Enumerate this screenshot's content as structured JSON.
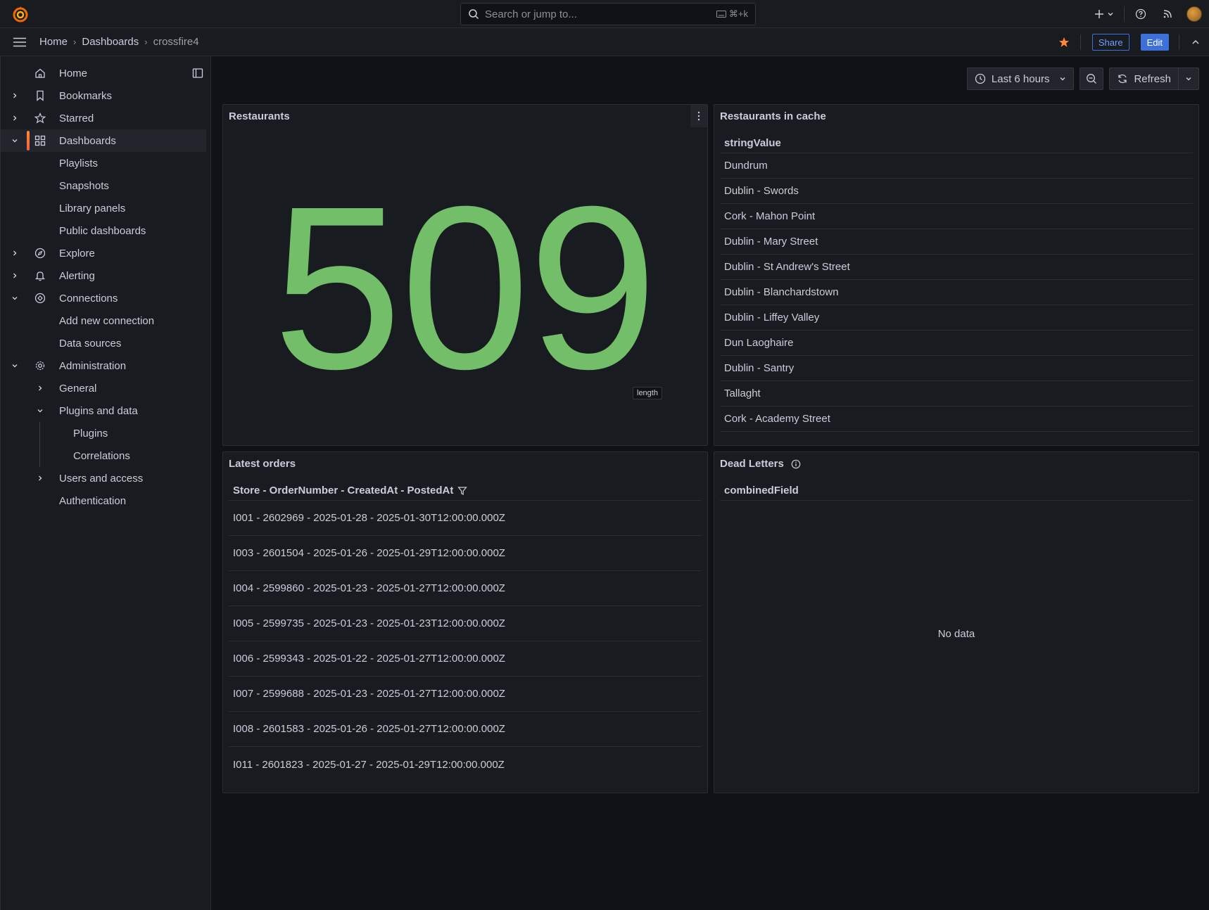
{
  "app": {
    "accent_color": "#3d71d9",
    "stat_color": "#73bf69",
    "favorite_color": "#ff8833"
  },
  "topbar": {
    "search_placeholder": "Search or jump to...",
    "search_shortcut": "⌘+k"
  },
  "breadcrumb": {
    "items": [
      "Home",
      "Dashboards",
      "crossfire4"
    ],
    "share_label": "Share",
    "edit_label": "Edit"
  },
  "sidebar": {
    "items": [
      {
        "label": "Home",
        "icon": "home-icon"
      },
      {
        "label": "Bookmarks",
        "icon": "bookmark-icon"
      },
      {
        "label": "Starred",
        "icon": "star-icon"
      },
      {
        "label": "Dashboards",
        "icon": "apps-icon"
      },
      {
        "label": "Playlists"
      },
      {
        "label": "Snapshots"
      },
      {
        "label": "Library panels"
      },
      {
        "label": "Public dashboards"
      },
      {
        "label": "Explore",
        "icon": "compass-icon"
      },
      {
        "label": "Alerting",
        "icon": "bell-icon"
      },
      {
        "label": "Connections",
        "icon": "connections-icon"
      },
      {
        "label": "Add new connection"
      },
      {
        "label": "Data sources"
      },
      {
        "label": "Administration",
        "icon": "cog-icon"
      },
      {
        "label": "General"
      },
      {
        "label": "Plugins and data"
      },
      {
        "label": "Plugins"
      },
      {
        "label": "Correlations"
      },
      {
        "label": "Users and access"
      },
      {
        "label": "Authentication"
      }
    ]
  },
  "toolbar": {
    "time_range": "Last 6 hours",
    "refresh_label": "Refresh"
  },
  "panels": {
    "restaurants": {
      "title": "Restaurants",
      "value": "509",
      "field_label": "length"
    },
    "cache": {
      "title": "Restaurants in cache",
      "column": "stringValue",
      "rows": [
        "Dundrum",
        "Dublin - Swords",
        "Cork - Mahon Point",
        "Dublin - Mary Street",
        "Dublin - St Andrew's Street",
        "Dublin - Blanchardstown",
        "Dublin - Liffey Valley",
        "Dun Laoghaire",
        "Dublin - Santry",
        "Tallaght",
        "Cork - Academy Street"
      ]
    },
    "orders": {
      "title": "Latest orders",
      "column": "Store - OrderNumber - CreatedAt - PostedAt",
      "rows": [
        "I001 - 2602969 - 2025-01-28 - 2025-01-30T12:00:00.000Z",
        "I003 - 2601504 - 2025-01-26 - 2025-01-29T12:00:00.000Z",
        "I004 - 2599860 - 2025-01-23 - 2025-01-27T12:00:00.000Z",
        "I005 - 2599735 - 2025-01-23 - 2025-01-23T12:00:00.000Z",
        "I006 - 2599343 - 2025-01-22 - 2025-01-27T12:00:00.000Z",
        "I007 - 2599688 - 2025-01-23 - 2025-01-27T12:00:00.000Z",
        "I008 - 2601583 - 2025-01-26 - 2025-01-27T12:00:00.000Z",
        "I011 - 2601823 - 2025-01-27 - 2025-01-29T12:00:00.000Z"
      ]
    },
    "dead_letters": {
      "title": "Dead Letters",
      "column": "combinedField",
      "empty_text": "No data"
    }
  }
}
